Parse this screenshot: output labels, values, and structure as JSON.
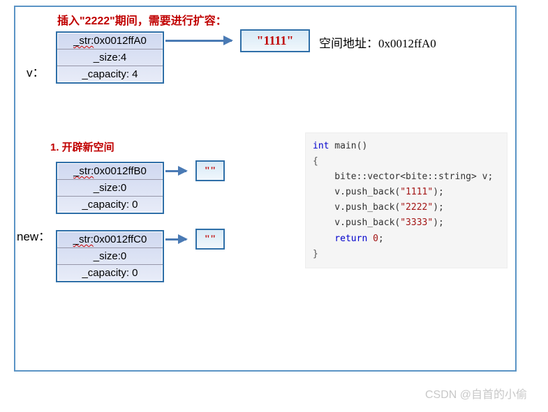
{
  "title": "插入\"2222\"期间，需要进行扩容：",
  "labels": {
    "v": "v：",
    "new": "new：",
    "addr": "空间地址：0x0012ffA0"
  },
  "section1": "1. 开辟新空间",
  "v_table": {
    "r1a": "_str:",
    "r1b": "0x0012ffA0",
    "r2": "_size:4",
    "r3": "_capacity: 4"
  },
  "box1": "\"1111\"",
  "new1": {
    "r1a": "_str:",
    "r1b": "0x0012ffB0",
    "r2": "_size:0",
    "r3": "_capacity: 0"
  },
  "new2": {
    "r1a": "_str:",
    "r1b": "0x0012ffC0",
    "r2": "_size:0",
    "r3": "_capacity: 0"
  },
  "empty_box": "\"\"",
  "code": {
    "l1a": "int",
    "l1b": " main()",
    "l2": "{",
    "l3": "    bite::vector<bite::string> v;",
    "l4a": "    v.push_back(",
    "l4b": "\"1111\"",
    "l4c": ");",
    "l5a": "    v.push_back(",
    "l5b": "\"2222\"",
    "l5c": ");",
    "l6a": "    v.push_back(",
    "l6b": "\"3333\"",
    "l6c": ");",
    "l7a": "    return ",
    "l7b": "0",
    "l7c": ";",
    "l8": "}"
  },
  "watermark": "CSDN @自首的小偷"
}
